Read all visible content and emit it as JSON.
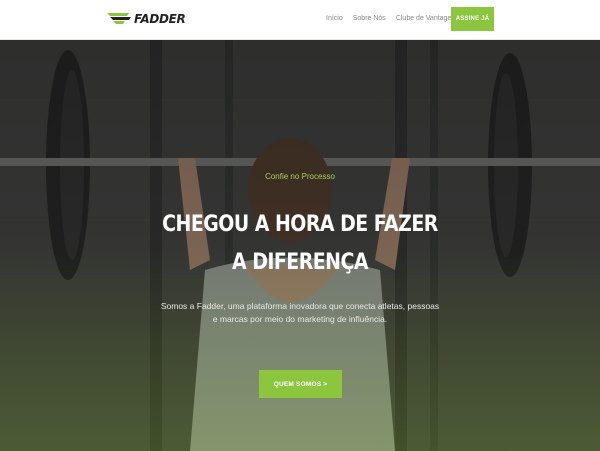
{
  "header": {
    "brand": "FADDER",
    "logo_icon": "fadder-wing-icon",
    "nav": [
      {
        "label": "Início"
      },
      {
        "label": "Sobre Nós"
      },
      {
        "label": "Clube de Vantagens"
      }
    ],
    "cta_label": "ASSINE JÁ"
  },
  "hero": {
    "background": "athlete-overhead-barbell-photo",
    "eyebrow": "Confie no Processo",
    "headline_line1": "CHEGOU A HORA DE FAZER",
    "headline_line2": "A DIFERENÇA",
    "description_line1": "Somos a Fadder, uma plataforma inovadora que conecta atletas, pessoas",
    "description_line2": "e marcas por meio do marketing de influência.",
    "cta_label": "QUEM SOMOS >"
  },
  "colors": {
    "accent": "#8cc63f",
    "eyebrow": "#a5d152",
    "header_bg": "#ffffff",
    "hero_dark": "#2b2d2c"
  }
}
